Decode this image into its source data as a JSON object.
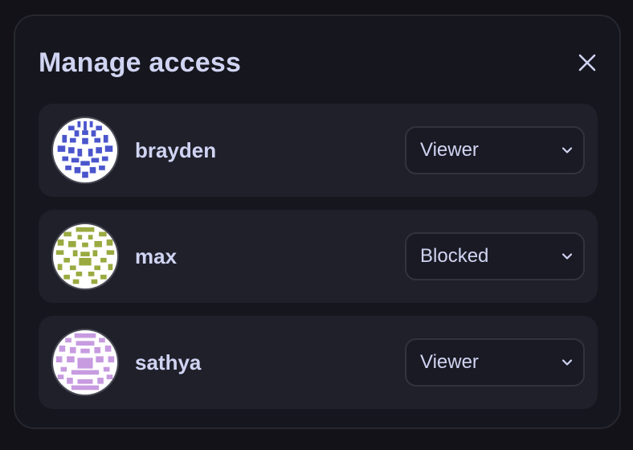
{
  "dialog": {
    "title": "Manage access",
    "close_icon": "close-icon"
  },
  "colors": {
    "accent_blue": "#4b55cc",
    "accent_olive": "#9aaa40",
    "accent_lilac": "#c79be0"
  },
  "users": [
    {
      "name": "brayden",
      "role": "Viewer",
      "avatar_color": "#4b55cc"
    },
    {
      "name": "max",
      "role": "Blocked",
      "avatar_color": "#9aaa40"
    },
    {
      "name": "sathya",
      "role": "Viewer",
      "avatar_color": "#c79be0"
    }
  ]
}
